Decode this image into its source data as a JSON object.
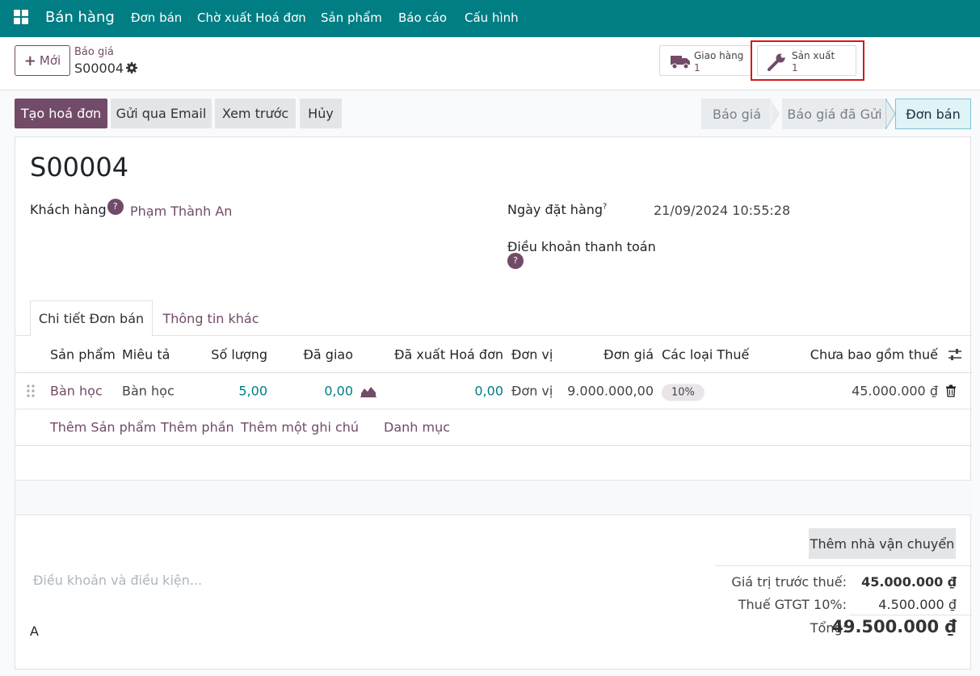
{
  "topbar": {
    "brand": "Bán hàng",
    "menu": [
      "Đơn bán",
      "Chờ xuất Hoá đơn",
      "Sản phẩm",
      "Báo cáo",
      "Cấu hình"
    ],
    "color": "#017e84"
  },
  "control": {
    "new_button": "Mới",
    "breadcrumb_parent": "Báo giá",
    "breadcrumb_current": "S00004",
    "smart_buttons": [
      {
        "label": "Giao hàng",
        "value": "1",
        "icon": "truck-icon"
      },
      {
        "label": "Sản xuất",
        "value": "1",
        "icon": "wrench-icon"
      }
    ]
  },
  "actions": {
    "buttons": [
      "Tạo hoá đơn",
      "Gửi qua Email",
      "Xem trước",
      "Hủy"
    ],
    "stages": [
      "Báo giá",
      "Báo giá đã Gửi",
      "Đơn bán"
    ],
    "active_stage": "Đơn bán"
  },
  "form": {
    "name": "S00004",
    "customer_label": "Khách hàng",
    "customer_value": "Phạm Thành An",
    "order_date_label": "Ngày đặt hàng",
    "order_date_sup": "?",
    "order_date_value": "21/09/2024 10:55:28",
    "payment_terms_label": "Điều khoản thanh toán",
    "help_glyph": "?"
  },
  "tabs": [
    "Chi tiết Đơn bán",
    "Thông tin khác"
  ],
  "table": {
    "headers": [
      "Sản phẩm",
      "Miêu tả",
      "Số lượng",
      "Đã giao",
      "Đã xuất Hoá đơn",
      "Đơn vị",
      "Đơn giá",
      "Các loại Thuế",
      "Chưa bao gồm thuế"
    ],
    "rows": [
      {
        "product": "Bàn học",
        "description": "Bàn học",
        "quantity": "5,00",
        "delivered": "0,00",
        "invoiced": "0,00",
        "unit": "Đơn vị",
        "price": "9.000.000,00",
        "tax": "10%",
        "subtotal": "45.000.000 ₫"
      }
    ],
    "add_links": [
      "Thêm Sản phẩm",
      "Thêm phần",
      "Thêm một ghi chú",
      "Danh mục"
    ]
  },
  "footer": {
    "carrier_button": "Thêm nhà vận chuyển",
    "terms_placeholder": "Điều khoản và điều kiện...",
    "note_text": "A",
    "untaxed_label": "Giá trị trước thuế:",
    "untaxed_value": "45.000.000 ₫",
    "tax_label": "Thuế GTGT 10%:",
    "tax_value": "4.500.000 ₫",
    "total_label": "Tổng:",
    "total_value": "49.500.000 ₫"
  }
}
